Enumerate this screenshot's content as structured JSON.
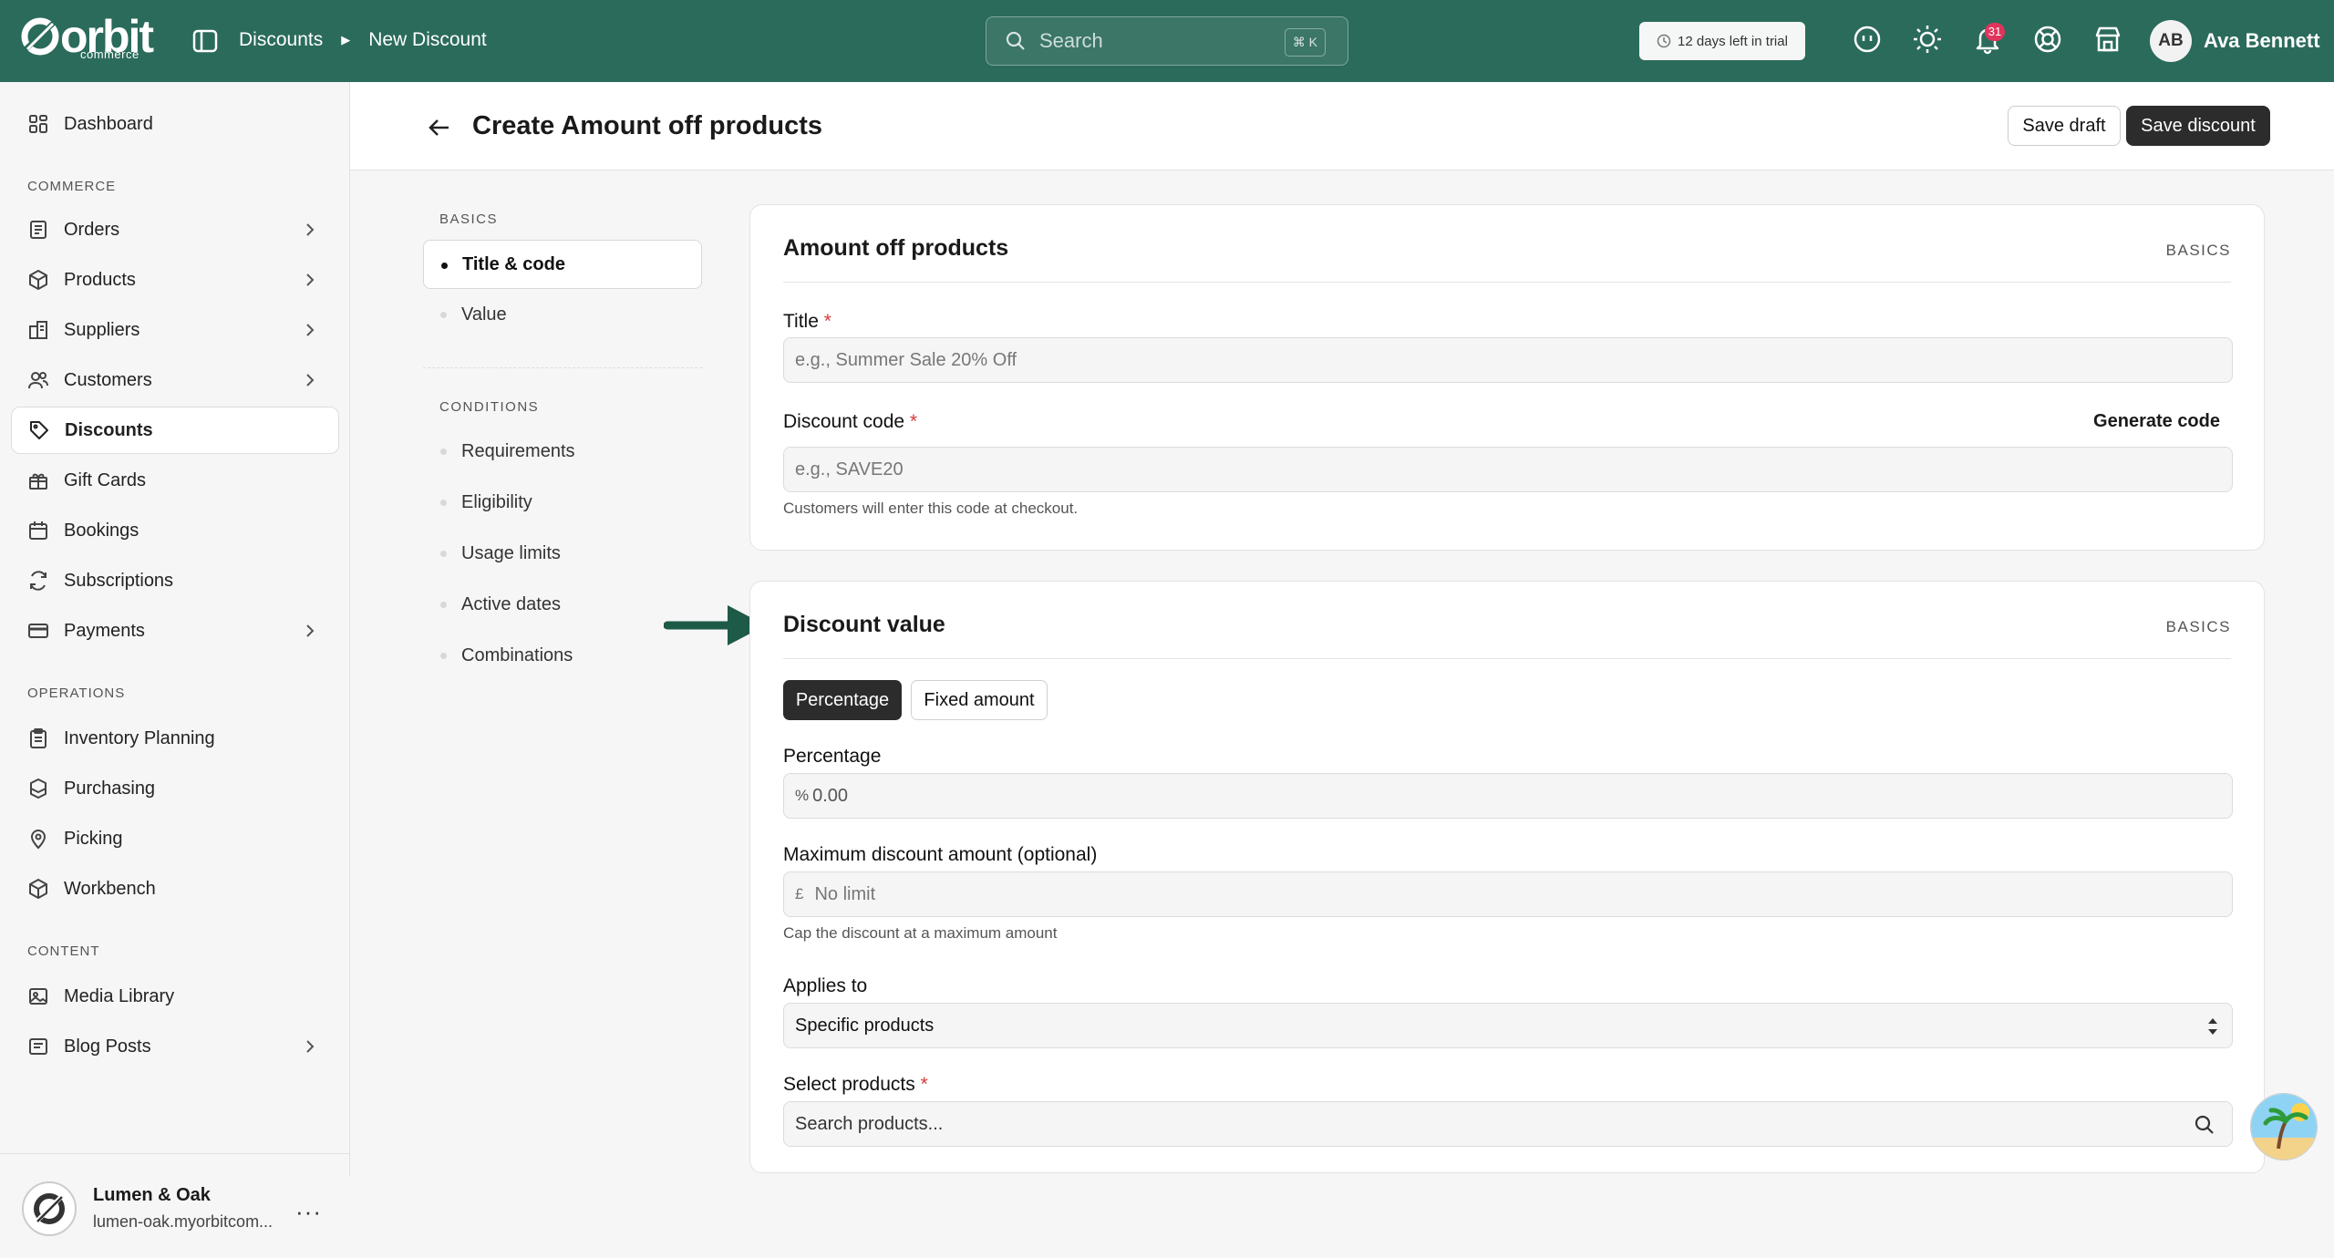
{
  "topbar": {
    "logo_text": "orbit",
    "logo_sub": "commerce",
    "breadcrumb": [
      "Discounts",
      "New Discount"
    ],
    "search_placeholder": "Search",
    "search_shortcut": "⌘ K",
    "trial_text": "12 days left in trial",
    "notification_count": "31",
    "user_initials": "AB",
    "user_name": "Ava Bennett",
    "icons": [
      "panel-toggle-icon",
      "search-icon",
      "clock-icon",
      "assistant-icon",
      "theme-sun-icon",
      "bell-icon",
      "help-lifebuoy-icon",
      "store-icon"
    ]
  },
  "sidebar": {
    "dashboard": "Dashboard",
    "sections": {
      "commerce": "COMMERCE",
      "operations": "OPERATIONS",
      "content": "CONTENT"
    },
    "commerce_items": [
      {
        "label": "Orders",
        "icon": "orders-icon",
        "has_children": true
      },
      {
        "label": "Products",
        "icon": "products-icon",
        "has_children": true
      },
      {
        "label": "Suppliers",
        "icon": "suppliers-icon",
        "has_children": true
      },
      {
        "label": "Customers",
        "icon": "customers-icon",
        "has_children": true
      },
      {
        "label": "Discounts",
        "icon": "tag-icon",
        "has_children": false,
        "active": true
      },
      {
        "label": "Gift Cards",
        "icon": "gift-icon",
        "has_children": false
      },
      {
        "label": "Bookings",
        "icon": "calendar-icon",
        "has_children": false
      },
      {
        "label": "Subscriptions",
        "icon": "refresh-icon",
        "has_children": false
      },
      {
        "label": "Payments",
        "icon": "card-icon",
        "has_children": true
      }
    ],
    "operations_items": [
      {
        "label": "Inventory Planning",
        "icon": "clipboard-icon"
      },
      {
        "label": "Purchasing",
        "icon": "boxes-icon"
      },
      {
        "label": "Picking",
        "icon": "pin-icon"
      },
      {
        "label": "Workbench",
        "icon": "box-icon"
      }
    ],
    "content_items": [
      {
        "label": "Media Library",
        "icon": "image-icon",
        "has_children": false
      },
      {
        "label": "Blog Posts",
        "icon": "blog-icon",
        "has_children": true
      }
    ],
    "store": {
      "name": "Lumen & Oak",
      "url": "lumen-oak.myorbitcom..."
    }
  },
  "header": {
    "title": "Create Amount off products",
    "save_draft": "Save draft",
    "save_discount": "Save discount"
  },
  "subnav": {
    "basics_label": "BASICS",
    "basics": [
      "Title & code",
      "Value"
    ],
    "conditions_label": "CONDITIONS",
    "conditions": [
      "Requirements",
      "Eligibility",
      "Usage limits",
      "Active dates",
      "Combinations"
    ]
  },
  "card1": {
    "title": "Amount off products",
    "tag": "BASICS",
    "title_label": "Title",
    "title_placeholder": "e.g., Summer Sale 20% Off",
    "code_label": "Discount code",
    "generate_code": "Generate code",
    "code_placeholder": "e.g., SAVE20",
    "code_help": "Customers will enter this code at checkout."
  },
  "card2": {
    "title": "Discount value",
    "tag": "BASICS",
    "seg_percentage": "Percentage",
    "seg_fixed": "Fixed amount",
    "percentage_label": "Percentage",
    "percentage_prefix": "%",
    "percentage_value": "0.00",
    "max_label": "Maximum discount amount (optional)",
    "max_prefix": "£",
    "max_placeholder": "No limit",
    "max_help": "Cap the discount at a maximum amount",
    "applies_label": "Applies to",
    "applies_value": "Specific products",
    "select_label": "Select products",
    "select_placeholder": "Search products..."
  },
  "colors": {
    "topbar": "#2b6b5b",
    "arrow": "#1e5a48",
    "required": "#d63b3b",
    "badge": "#e0345c"
  }
}
